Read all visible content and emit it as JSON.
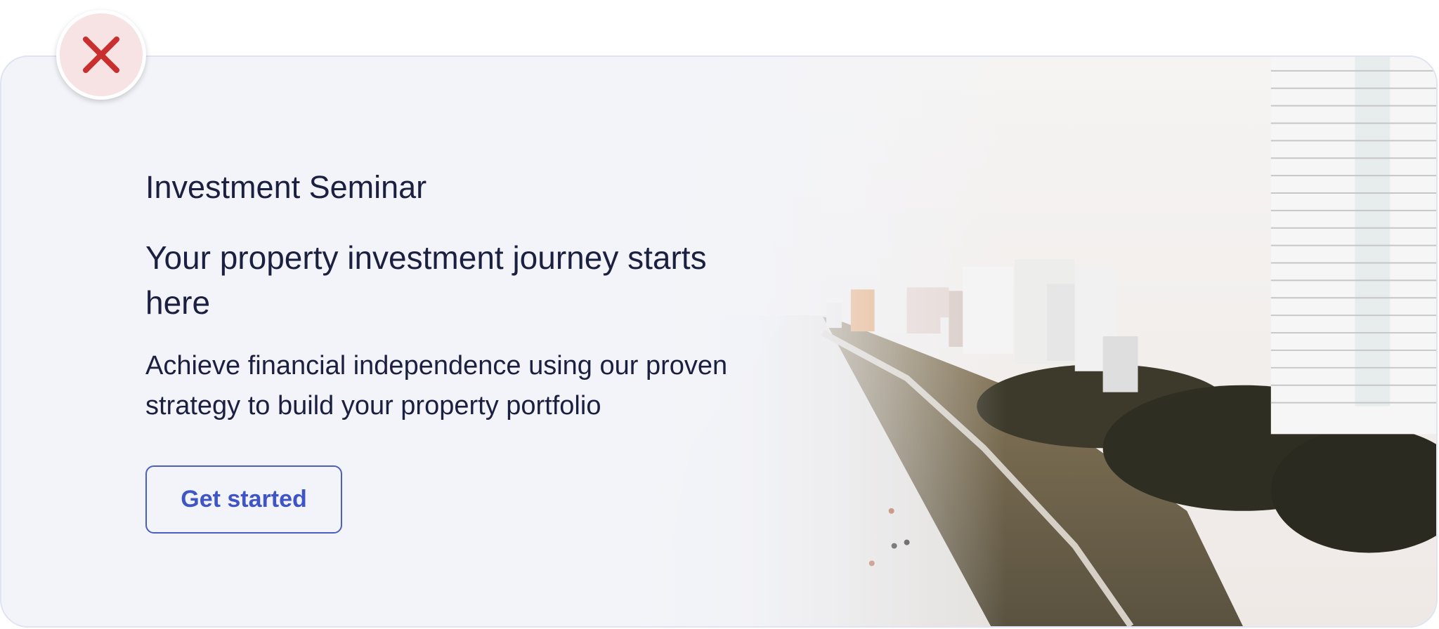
{
  "banner": {
    "eyebrow": "Investment Seminar",
    "headline": "Your property investment journey starts here",
    "subtext": "Achieve financial independence using our proven strategy to build your property portfolio",
    "cta_label": "Get started"
  },
  "close_button": {
    "icon": "close-icon",
    "color": "#c8302f",
    "background": "#f8e3e4"
  },
  "image": {
    "subject": "beachfront-high-rise-hotels"
  },
  "colors": {
    "text": "#1c2040",
    "accent": "#3f55c6",
    "card_background": "#f3f4f9",
    "card_border": "#dfe3f2"
  }
}
